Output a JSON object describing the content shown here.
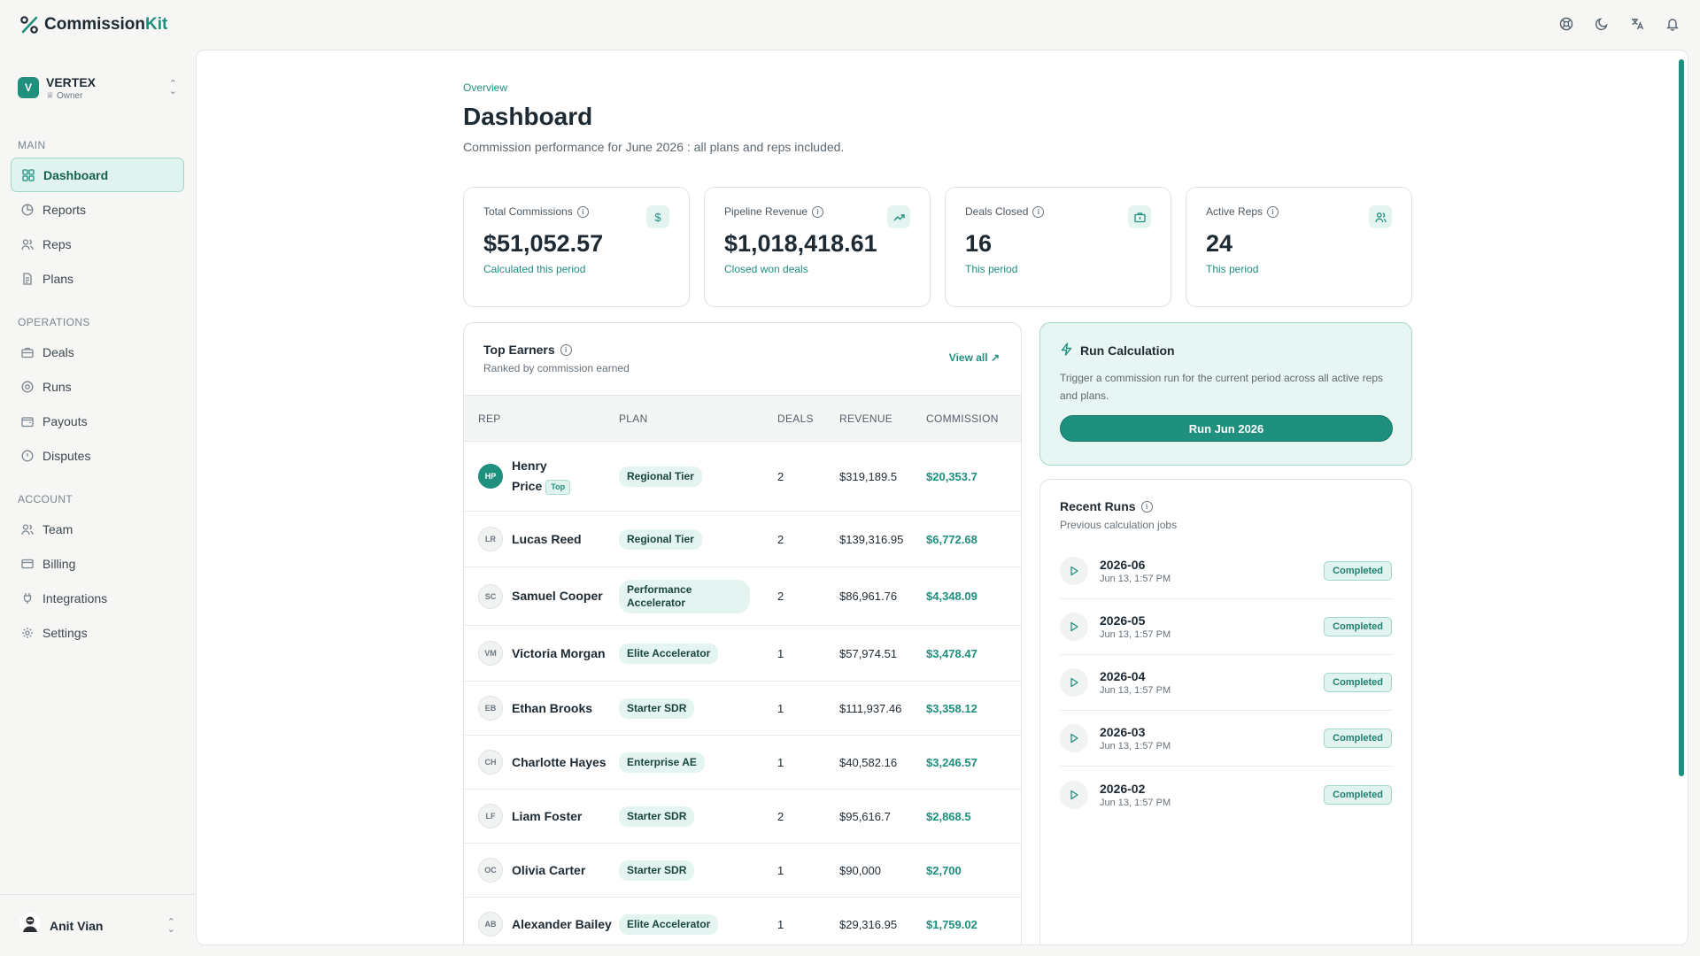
{
  "app": {
    "brand_part1": "Commission",
    "brand_part2": "Kit"
  },
  "topbar": {
    "icons": [
      "support-icon",
      "dark-mode-icon",
      "translate-icon",
      "notifications-icon"
    ]
  },
  "sidebar": {
    "org": {
      "initial": "V",
      "name": "VERTEX",
      "role": "Owner"
    },
    "sections": {
      "main": "MAIN",
      "operations": "OPERATIONS",
      "account": "ACCOUNT"
    },
    "main_items": [
      {
        "label": "Dashboard"
      },
      {
        "label": "Reports"
      },
      {
        "label": "Reps"
      },
      {
        "label": "Plans"
      }
    ],
    "operations_items": [
      {
        "label": "Deals"
      },
      {
        "label": "Runs"
      },
      {
        "label": "Payouts"
      },
      {
        "label": "Disputes"
      }
    ],
    "account_items": [
      {
        "label": "Team"
      },
      {
        "label": "Billing"
      },
      {
        "label": "Integrations"
      },
      {
        "label": "Settings"
      }
    ],
    "user": {
      "name": "Anit Vian"
    }
  },
  "page": {
    "breadcrumb": "Overview",
    "title": "Dashboard",
    "subtitle": "Commission performance for June 2026 : all plans and reps included."
  },
  "stats": [
    {
      "label": "Total Commissions",
      "value": "$51,052.57",
      "note": "Calculated this period",
      "icon": "dollar-icon"
    },
    {
      "label": "Pipeline Revenue",
      "value": "$1,018,418.61",
      "note": "Closed won deals",
      "icon": "trending-up-icon"
    },
    {
      "label": "Deals Closed",
      "value": "16",
      "note": "This period",
      "icon": "briefcase-icon"
    },
    {
      "label": "Active Reps",
      "value": "24",
      "note": "This period",
      "icon": "users-icon"
    }
  ],
  "earners": {
    "title": "Top Earners",
    "subtitle": "Ranked by commission earned",
    "view_all": "View all",
    "columns": {
      "rep": "REP",
      "plan": "PLAN",
      "deals": "DEALS",
      "revenue": "REVENUE",
      "commission": "COMMISSION"
    },
    "top_tag": "Top",
    "rows": [
      {
        "initials": "HP",
        "name_line1": "Henry",
        "name_line2": "Price",
        "plan": "Regional Tier",
        "deals": "2",
        "revenue": "$319,189.5",
        "commission": "$20,353.7"
      },
      {
        "initials": "LR",
        "name": "Lucas Reed",
        "plan": "Regional Tier",
        "deals": "2",
        "revenue": "$139,316.95",
        "commission": "$6,772.68"
      },
      {
        "initials": "SC",
        "name": "Samuel Cooper",
        "plan": "Performance Accelerator",
        "deals": "2",
        "revenue": "$86,961.76",
        "commission": "$4,348.09"
      },
      {
        "initials": "VM",
        "name": "Victoria Morgan",
        "plan": "Elite Accelerator",
        "deals": "1",
        "revenue": "$57,974.51",
        "commission": "$3,478.47"
      },
      {
        "initials": "EB",
        "name": "Ethan Brooks",
        "plan": "Starter SDR",
        "deals": "1",
        "revenue": "$111,937.46",
        "commission": "$3,358.12"
      },
      {
        "initials": "CH",
        "name": "Charlotte Hayes",
        "plan": "Enterprise AE",
        "deals": "1",
        "revenue": "$40,582.16",
        "commission": "$3,246.57"
      },
      {
        "initials": "LF",
        "name": "Liam Foster",
        "plan": "Starter SDR",
        "deals": "2",
        "revenue": "$95,616.7",
        "commission": "$2,868.5"
      },
      {
        "initials": "OC",
        "name": "Olivia Carter",
        "plan": "Starter SDR",
        "deals": "1",
        "revenue": "$90,000",
        "commission": "$2,700"
      },
      {
        "initials": "AB",
        "name": "Alexander Bailey",
        "plan": "Elite Accelerator",
        "deals": "1",
        "revenue": "$29,316.95",
        "commission": "$1,759.02"
      }
    ]
  },
  "run_calc": {
    "title": "Run Calculation",
    "description": "Trigger a commission run for the current period across all active reps and plans.",
    "button": "Run Jun 2026"
  },
  "recent_runs": {
    "title": "Recent Runs",
    "subtitle": "Previous calculation jobs",
    "items": [
      {
        "name": "2026-06",
        "time": "Jun 13, 1:57 PM",
        "status": "Completed"
      },
      {
        "name": "2026-05",
        "time": "Jun 13, 1:57 PM",
        "status": "Completed"
      },
      {
        "name": "2026-04",
        "time": "Jun 13, 1:57 PM",
        "status": "Completed"
      },
      {
        "name": "2026-03",
        "time": "Jun 13, 1:57 PM",
        "status": "Completed"
      },
      {
        "name": "2026-02",
        "time": "Jun 13, 1:57 PM",
        "status": "Completed"
      }
    ]
  },
  "colors": {
    "accent": "#1f8f7e",
    "accent_light": "#e1f3ef",
    "sidebar_bg": "#f6f6f5"
  }
}
